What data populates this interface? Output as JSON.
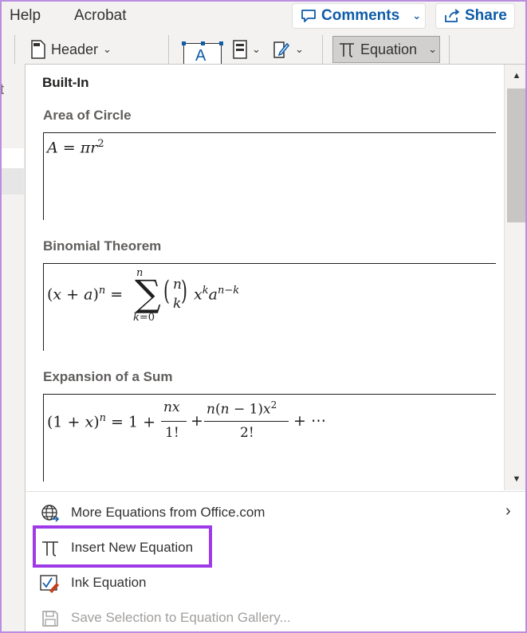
{
  "menubar": {
    "tabs": [
      "Help",
      "Acrobat"
    ],
    "comments_label": "Comments",
    "share_label": "Share"
  },
  "ribbon": {
    "header_label": "Header",
    "equation_label": "Equation",
    "stub_letter": "t"
  },
  "gallery": {
    "section_title": "Built-In",
    "equations": [
      {
        "title": "Area of Circle"
      },
      {
        "title": "Binomial Theorem"
      },
      {
        "title": "Expansion of a Sum"
      }
    ]
  },
  "menu": {
    "more_label": "More Equations from Office.com",
    "insert_label": "Insert New Equation",
    "ink_label": "Ink Equation",
    "save_label": "Save Selection to Equation Gallery..."
  },
  "colors": {
    "accent": "#0f5ca8",
    "highlight": "#9e3be6"
  },
  "icons": {
    "comments": "comment-icon",
    "share": "share-icon",
    "header": "header-icon",
    "equation": "pi-icon",
    "globe": "globe-icon",
    "ink": "ink-equation-icon",
    "save": "save-icon"
  }
}
